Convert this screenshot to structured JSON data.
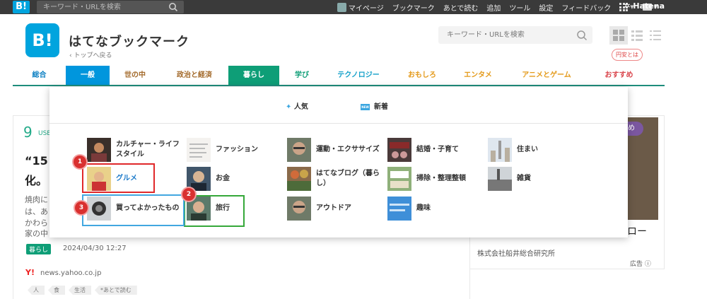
{
  "topbar": {
    "logo": "B!",
    "search_placeholder": "キーワード・URLを検索",
    "nav": [
      "マイページ",
      "ブックマーク",
      "あとで読む",
      "追加",
      "ツール",
      "設定",
      "フィードバック"
    ],
    "brand": "Hatena"
  },
  "header": {
    "logo": "B!",
    "title": "はてなブックマーク",
    "back_link": "‹ トップへ戻る",
    "search_placeholder": "キーワード・URLを検索",
    "about_badge": "円安とは"
  },
  "categories": [
    {
      "label": "総合",
      "color": "#0a7fc2",
      "state": "normal"
    },
    {
      "label": "一般",
      "color": "#ffffff",
      "state": "active-blue"
    },
    {
      "label": "世の中",
      "color": "#a36a2b",
      "state": "normal"
    },
    {
      "label": "政治と経済",
      "color": "#a36a2b",
      "state": "normal"
    },
    {
      "label": "暮らし",
      "color": "#ffffff",
      "state": "active-green"
    },
    {
      "label": "学び",
      "color": "#0e9e77",
      "state": "normal"
    },
    {
      "label": "テクノロジー",
      "color": "#13a0c9",
      "state": "normal"
    },
    {
      "label": "おもしろ",
      "color": "#e49a1a",
      "state": "normal"
    },
    {
      "label": "エンタメ",
      "color": "#e49a1a",
      "state": "normal"
    },
    {
      "label": "アニメとゲーム",
      "color": "#e49a1a",
      "state": "normal"
    },
    {
      "label": "おすすめ",
      "color": "#d9434a",
      "state": "normal"
    }
  ],
  "dropdown": {
    "popular": "人気",
    "newest": "新着",
    "new_icon": "NEW",
    "subcategories": [
      {
        "label": "カルチャー・ライフ",
        "label2": "スタイル"
      },
      {
        "label": "グルメ"
      },
      {
        "label": "買ってよかったもの"
      },
      {
        "label": "ファッション"
      },
      {
        "label": "お金"
      },
      {
        "label": "旅行"
      },
      {
        "label": "運動・エクササイズ"
      },
      {
        "label": "はてなブログ（暮ら",
        "label2": "し）"
      },
      {
        "label": "アウトドア"
      },
      {
        "label": "結婚・子育て"
      },
      {
        "label": "掃除・整理整頓"
      },
      {
        "label": "趣味"
      },
      {
        "label": "住まい"
      },
      {
        "label": "雑貨"
      }
    ],
    "markers": [
      "1",
      "2",
      "3"
    ]
  },
  "article": {
    "count": "9",
    "users": "USE",
    "title_line1": "“15",
    "title_line2": "化。",
    "excerpt": [
      "焼肉に",
      "は、あ",
      "かわら",
      "家の中"
    ],
    "category": "暮らし",
    "date": "2024/04/30 12:27",
    "source_logo": "Y!",
    "source": "news.yahoo.co.jp",
    "tags": [
      "人",
      "食",
      "生活",
      "*あとで読む"
    ]
  },
  "sidebar_ad": {
    "badge": "め",
    "title_fragment": "ロー",
    "sponsor": "株式会社船井総合研究所",
    "ad_label": "広告"
  },
  "colors": {
    "brand_blue": "#00a4de",
    "category_underline": "#1e8d7c",
    "highlight_red": "#e0282a",
    "highlight_green": "#35a83a",
    "highlight_blue": "#42a7e0"
  }
}
